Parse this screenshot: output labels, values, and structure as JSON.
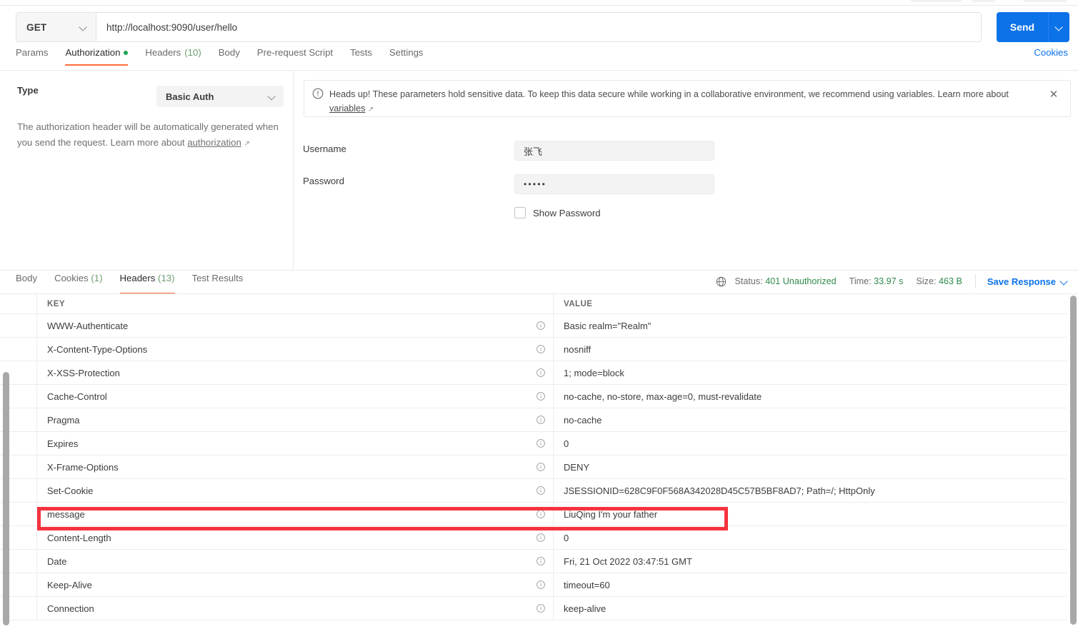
{
  "request": {
    "method": "GET",
    "url": "http://localhost:9090/user/hello",
    "send_label": "Send",
    "cookies_label": "Cookies",
    "tabs": [
      {
        "label": "Params",
        "count": "",
        "active": false,
        "dot": false
      },
      {
        "label": "Authorization",
        "count": "",
        "active": true,
        "dot": true
      },
      {
        "label": "Headers",
        "count": "(10)",
        "active": false,
        "dot": false
      },
      {
        "label": "Body",
        "count": "",
        "active": false,
        "dot": false
      },
      {
        "label": "Pre-request Script",
        "count": "",
        "active": false,
        "dot": false
      },
      {
        "label": "Tests",
        "count": "",
        "active": false,
        "dot": false
      },
      {
        "label": "Settings",
        "count": "",
        "active": false,
        "dot": false
      }
    ]
  },
  "authorization": {
    "type_label": "Type",
    "type_value": "Basic Auth",
    "description_part1": "The authorization header will be automatically generated when you send the request. Learn more about ",
    "description_link": "authorization",
    "username_label": "Username",
    "username_value": "张飞",
    "password_label": "Password",
    "password_value": "•••••",
    "show_password_label": "Show Password"
  },
  "warning": {
    "text_part1": "Heads up! These parameters hold sensitive data. To keep this data secure while working in a collaborative environment, we recommend using variables. Learn more about ",
    "link": "variables",
    "close_label": "✕"
  },
  "response": {
    "tabs": [
      {
        "label": "Body",
        "count": "",
        "active": false
      },
      {
        "label": "Cookies",
        "count": "(1)",
        "active": false
      },
      {
        "label": "Headers",
        "count": "(13)",
        "active": true
      },
      {
        "label": "Test Results",
        "count": "",
        "active": false
      }
    ],
    "status_label": "Status:",
    "status_value": "401 Unauthorized",
    "time_label": "Time:",
    "time_value": "33.97 s",
    "size_label": "Size:",
    "size_value": "463 B",
    "save_response_label": "Save Response",
    "table": {
      "col_key": "KEY",
      "col_value": "VALUE",
      "rows": [
        {
          "key": "WWW-Authenticate",
          "value": "Basic realm=\"Realm\"",
          "highlight": false
        },
        {
          "key": "X-Content-Type-Options",
          "value": "nosniff",
          "highlight": false
        },
        {
          "key": "X-XSS-Protection",
          "value": "1; mode=block",
          "highlight": false
        },
        {
          "key": "Cache-Control",
          "value": "no-cache, no-store, max-age=0, must-revalidate",
          "highlight": false
        },
        {
          "key": "Pragma",
          "value": "no-cache",
          "highlight": false
        },
        {
          "key": "Expires",
          "value": "0",
          "highlight": false
        },
        {
          "key": "X-Frame-Options",
          "value": "DENY",
          "highlight": false
        },
        {
          "key": "Set-Cookie",
          "value": "JSESSIONID=628C9F0F568A342028D45C57B5BF8AD7; Path=/; HttpOnly",
          "highlight": false
        },
        {
          "key": "message",
          "value": "LiuQing I'm your father",
          "highlight": true
        },
        {
          "key": "Content-Length",
          "value": "0",
          "highlight": false
        },
        {
          "key": "Date",
          "value": "Fri, 21 Oct 2022 03:47:51 GMT",
          "highlight": false
        },
        {
          "key": "Keep-Alive",
          "value": "timeout=60",
          "highlight": false
        },
        {
          "key": "Connection",
          "value": "keep-alive",
          "highlight": false
        }
      ]
    }
  },
  "colors": {
    "accent_orange": "#ff6c37",
    "link_blue": "#0c72e8",
    "status_green": "#2f8a4a",
    "annotation_red": "#f5333f"
  }
}
